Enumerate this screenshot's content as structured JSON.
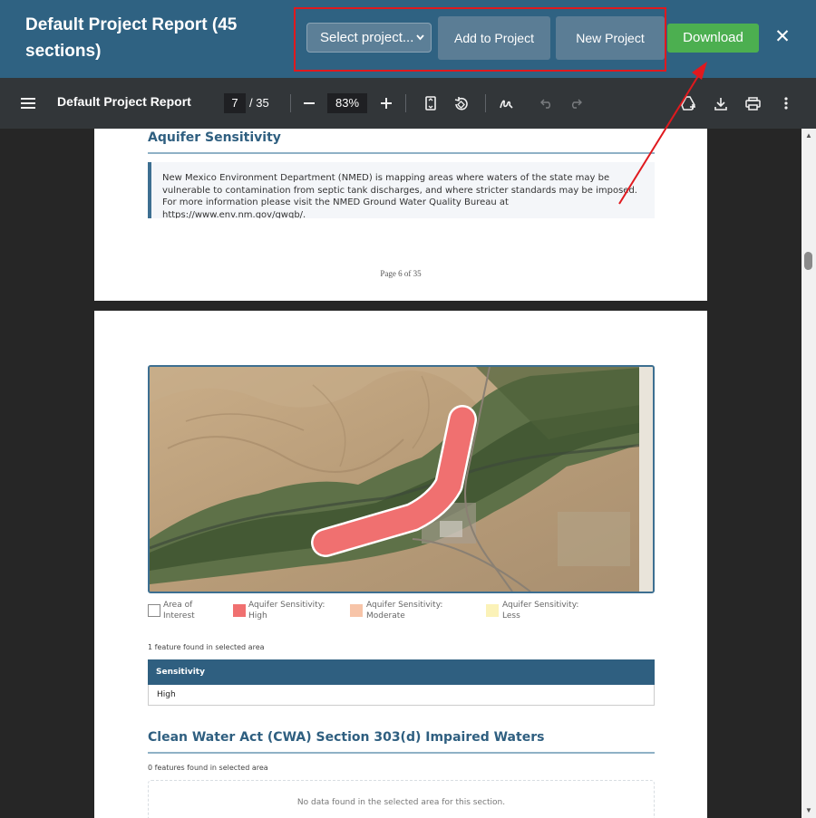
{
  "header": {
    "title": "Default Project Report (45 sections)",
    "select_placeholder": "Select project...",
    "add_label": "Add to Project",
    "new_label": "New Project",
    "download_label": "Download",
    "close_glyph": "✕"
  },
  "pdf_toolbar": {
    "doc_name": "Default Project Report",
    "current_page": "7",
    "total_pages": "/ 35",
    "zoom": "83%"
  },
  "page_prev": {
    "heading": "Aquifer Sensitivity",
    "notice": "New Mexico Environment Department (NMED) is mapping areas where waters of the state may be vulnerable to contamination from septic tank discharges, and where stricter standards may be imposed. For more information please visit the NMED Ground Water Quality Bureau at https://www.env.nm.gov/gwqb/.",
    "page_label": "Page 6 of 35"
  },
  "page_current": {
    "legend": [
      {
        "label": "Area of Interest",
        "color": "#ffffff"
      },
      {
        "label": "Aquifer Sensitivity: High",
        "color": "#f07070"
      },
      {
        "label": "Aquifer Sensitivity: Moderate",
        "color": "#f7c4a8"
      },
      {
        "label": "Aquifer Sensitivity: Less",
        "color": "#fbf2b8"
      }
    ],
    "features_found": "1 feature found in selected area",
    "table_header": "Sensitivity",
    "table_value": "High",
    "section2_heading": "Clean Water Act (CWA) Section 303(d) Impaired Waters",
    "section2_features": "0 features found in selected area",
    "no_data": "No data found in the selected area for this section."
  },
  "colors": {
    "header_bg": "#2f6282",
    "download_bg": "#4caf50",
    "highlight_border": "#e0191e",
    "accent": "#2f5f80"
  }
}
